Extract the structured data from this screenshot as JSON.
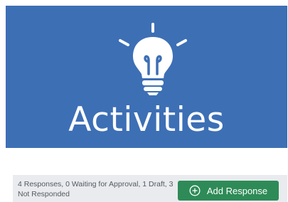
{
  "banner": {
    "title": "Activities",
    "icon": "lightbulb-icon",
    "background_color": "#3d6fb5"
  },
  "status": {
    "summary": "4 Responses, 0 Waiting for Approval, 1 Draft, 3 Not Responded"
  },
  "actions": {
    "add_response_label": "Add Response",
    "add_response_icon": "plus-circle-icon",
    "button_color": "#2e8b57"
  }
}
